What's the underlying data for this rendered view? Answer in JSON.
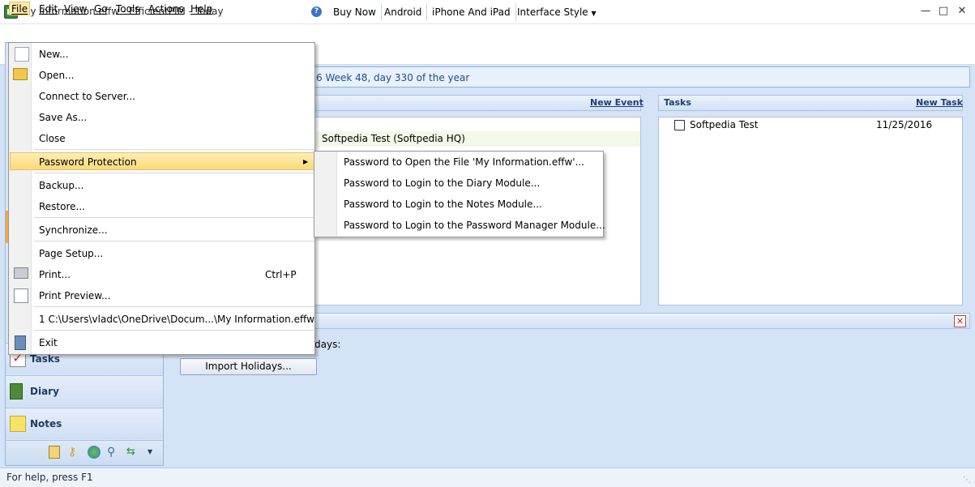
{
  "window": {
    "title": "My Information.effw - EfficientPIM - Today"
  },
  "menubar": {
    "file": "File",
    "edit": "Edit",
    "view": "View",
    "go": "Go",
    "tools": "Tools",
    "actions": "Actions",
    "help": "Help"
  },
  "toolbar": {
    "buy_now": "Buy Now",
    "android": "Android",
    "iphone": "iPhone And iPad",
    "interface_style": "Interface Style"
  },
  "datebar": {
    "text": "6  Week 48, day 330 of the year"
  },
  "events_panel": {
    "new_event": "New Event",
    "event_entry": "Softpedia Test (Softpedia  HQ)"
  },
  "tasks_panel": {
    "title": "Tasks",
    "new_task": "New Task",
    "task_name": "Softpedia Test",
    "task_date": "11/25/2016"
  },
  "holidays_panel": {
    "text_fragment": "days:",
    "import_button": "Import Holidays..."
  },
  "sidebar": {
    "tasks": "Tasks",
    "diary": "Diary",
    "notes": "Notes"
  },
  "file_menu": {
    "new": "New...",
    "open": "Open...",
    "connect": "Connect to Server...",
    "save_as": "Save As...",
    "close": "Close",
    "password_protection": "Password Protection",
    "backup": "Backup...",
    "restore": "Restore...",
    "synchronize": "Synchronize...",
    "page_setup": "Page Setup...",
    "print": "Print...",
    "print_shortcut": "Ctrl+P",
    "print_preview": "Print Preview...",
    "recent_file": "1 C:\\Users\\vladc\\OneDrive\\Docum...\\My Information.effw",
    "exit": "Exit"
  },
  "password_submenu": {
    "open_file": "Password to Open the File 'My Information.effw'...",
    "diary": "Password to Login to the Diary Module...",
    "notes": "Password to Login to the Notes Module...",
    "password_manager": "Password to Login to the Password Manager Module..."
  },
  "statusbar": {
    "text": "For help, press F1"
  },
  "colors": {
    "menu_highlight": "#fbd97c",
    "panel_border": "#a7c3e6",
    "link": "#1e3f73"
  }
}
